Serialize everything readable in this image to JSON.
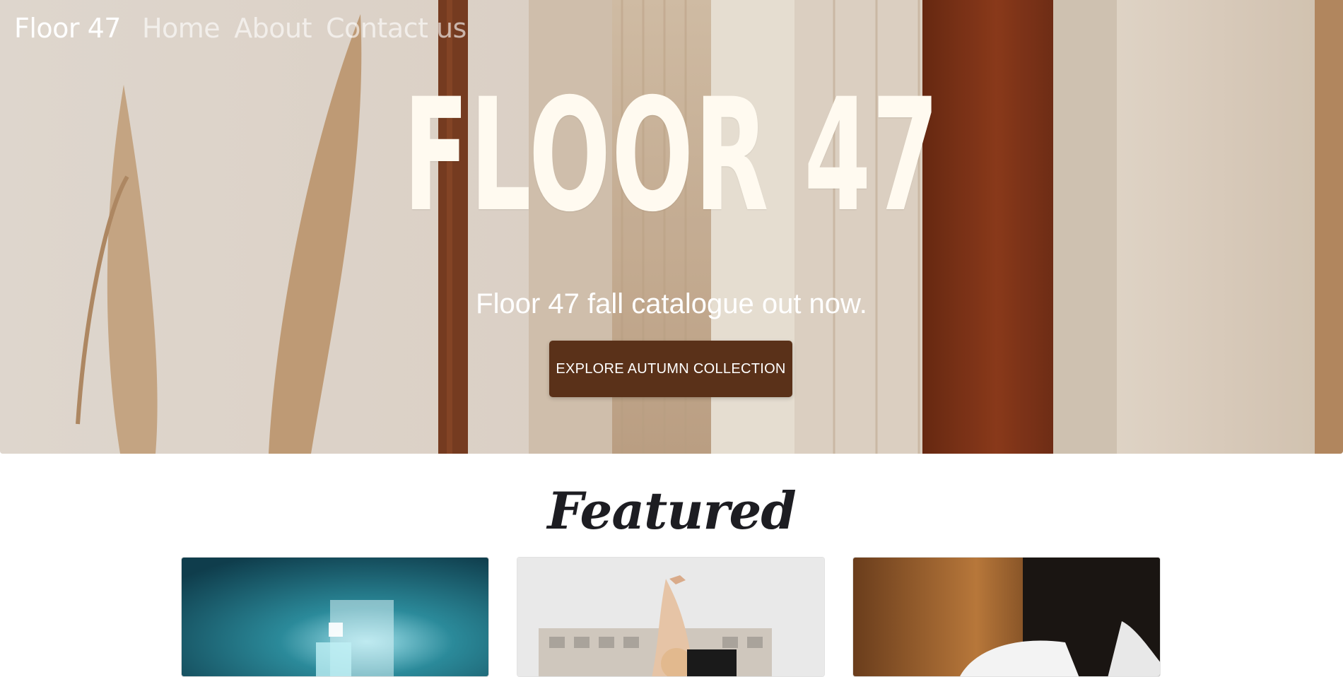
{
  "navbar": {
    "brand": "Floor 47",
    "links": [
      "Home",
      "About",
      "Contact us"
    ]
  },
  "hero": {
    "title": "FLOOR 47",
    "subtitle": "Floor 47 fall catalogue out now.",
    "cta_label": "EXPLORE AUTUMN COLLECTION"
  },
  "featured": {
    "heading": "Featured"
  },
  "colors": {
    "cta": "#5a3119",
    "title": "#fffaf0",
    "heading": "#1d1d22"
  }
}
